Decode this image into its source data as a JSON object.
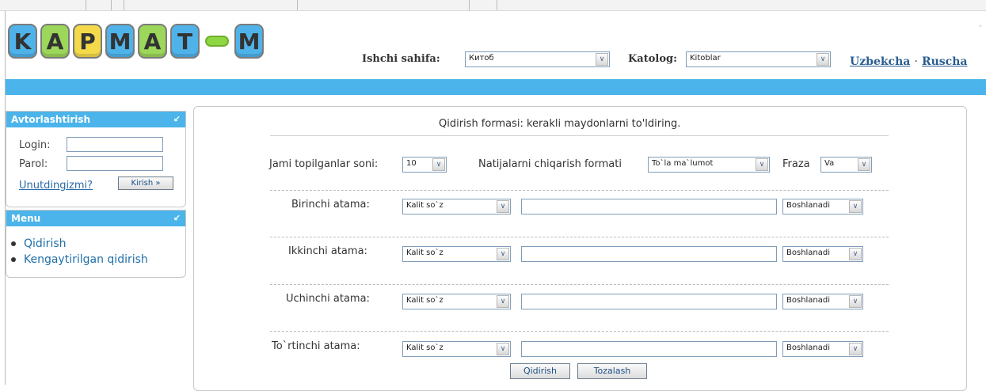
{
  "logo": {
    "letters": [
      "K",
      "A",
      "P",
      "M",
      "A",
      "T",
      "M"
    ],
    "tile_colors": [
      "#4fb3ea",
      "#9cd65a",
      "#f4d94a",
      "#4fb3ea",
      "#9cd65a",
      "#4fb3ea",
      "#4fb3ea"
    ],
    "accent": "#8ed642"
  },
  "header": {
    "work_page_label": "Ishchi sahifa:",
    "work_page_value": "Китоб",
    "catalog_label": "Katolog:",
    "catalog_value": "Kitoblar",
    "lang_uz": "Uzbekcha",
    "lang_sep": "·",
    "lang_ru": "Ruscha"
  },
  "colors": {
    "bluebar": "#4bb4ea",
    "link": "#2a6aa8"
  },
  "auth": {
    "title": "Avtorlashtirish",
    "collapse_icon": "arrow-down-left-icon",
    "login_label": "Login:",
    "password_label": "Parol:",
    "forgot_link": "Unutdingizmi?",
    "submit_label": "Kirish »"
  },
  "menu": {
    "title": "Menu",
    "items": [
      "Qidirish",
      "Kengaytirilgan qidirish"
    ]
  },
  "search": {
    "heading": "Qidirish formasi: kerakli maydonlarni to'ldiring.",
    "total_label": "Jami topilganlar soni:",
    "total_value": "10",
    "format_label": "Natijalarni chiqarish formati",
    "format_value": "To`la ma`lumot",
    "phrase_label": "Fraza",
    "phrase_value": "Va",
    "rows": [
      {
        "label": "Birinchi atama:",
        "field": "Kalit so`z",
        "match": "Boshlanadi"
      },
      {
        "label": "Ikkinchi atama:",
        "field": "Kalit so`z",
        "match": "Boshlanadi"
      },
      {
        "label": "Uchinchi atama:",
        "field": "Kalit so`z",
        "match": "Boshlanadi"
      },
      {
        "label": "To`rtinchi atama:",
        "field": "Kalit so`z",
        "match": "Boshlanadi"
      }
    ],
    "search_button": "Qidirish",
    "clear_button": "Tozalash"
  }
}
